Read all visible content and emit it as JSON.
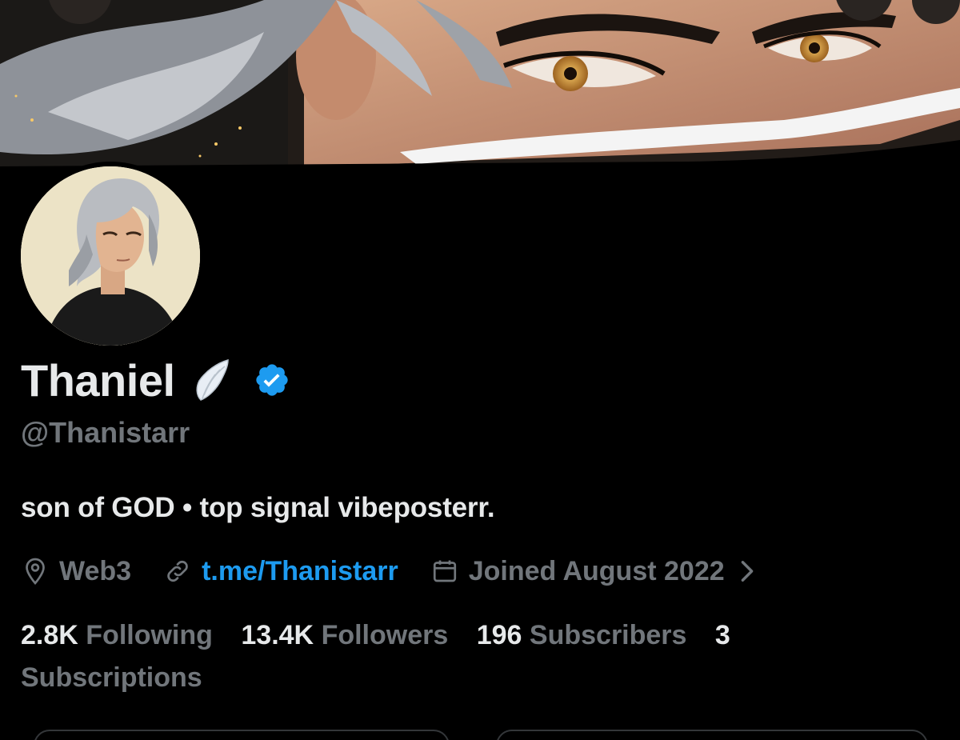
{
  "profile": {
    "display_name": "Thaniel",
    "handle": "@Thanistarr",
    "bio": "son of GOD • top signal vibeposterr.",
    "location": "Web3",
    "link": "t.me/Thanistarr",
    "joined": "Joined August 2022",
    "verified": true
  },
  "stats": {
    "following_count": "2.8K",
    "following_label": "Following",
    "followers_count": "13.4K",
    "followers_label": "Followers",
    "subscribers_count": "196",
    "subscribers_label": "Subscribers",
    "subscriptions_count": "3",
    "subscriptions_label": "Subscriptions"
  },
  "icons": {
    "location": "location-pin-icon",
    "link": "link-icon",
    "calendar": "calendar-icon",
    "verified": "verified-badge-icon",
    "wing": "wing-emoji-icon",
    "chevron": "chevron-right-icon"
  },
  "colors": {
    "background": "#000000",
    "text_primary": "#e7e9ea",
    "text_secondary": "#71767b",
    "accent": "#1d9bf0"
  }
}
